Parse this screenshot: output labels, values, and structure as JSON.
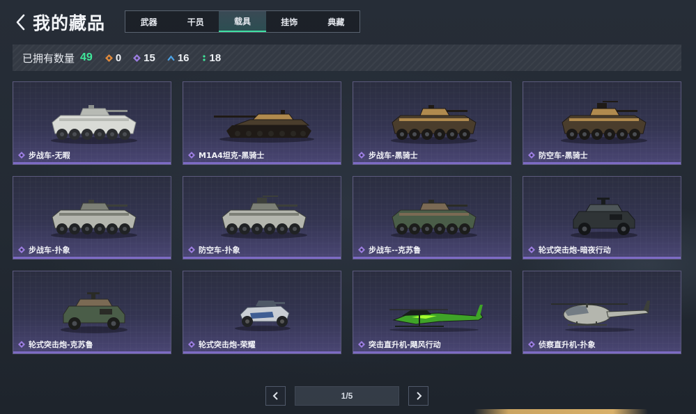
{
  "header": {
    "back_icon": "chevron-left-icon",
    "title": "我的藏品",
    "tabs": [
      {
        "label": "武器",
        "active": false
      },
      {
        "label": "干员",
        "active": false
      },
      {
        "label": "载具",
        "active": true
      },
      {
        "label": "挂饰",
        "active": false
      },
      {
        "label": "典藏",
        "active": false
      }
    ],
    "accent_color": "#3fe0a3"
  },
  "counts": {
    "label": "已拥有数量",
    "total": "49",
    "stats": [
      {
        "icon": "orange-diamond-icon",
        "color": "#e08a3c",
        "value": "0"
      },
      {
        "icon": "purple-diamond-icon",
        "color": "#9b7de0",
        "value": "15"
      },
      {
        "icon": "blue-chevron-icon",
        "color": "#4da3e6",
        "value": "16"
      },
      {
        "icon": "green-dots-icon",
        "color": "#3fe89b",
        "value": "18"
      }
    ]
  },
  "items": [
    {
      "name": "步战车-无暇",
      "kind": "apc",
      "palette": "snow"
    },
    {
      "name": "M1A4坦克-黑骑士",
      "kind": "tank",
      "palette": "darkgold"
    },
    {
      "name": "步战车-黑骑士",
      "kind": "apc",
      "palette": "darkgold"
    },
    {
      "name": "防空车-黑骑士",
      "kind": "aa",
      "palette": "darkgold"
    },
    {
      "name": "步战车-扑象",
      "kind": "apc",
      "palette": "camo"
    },
    {
      "name": "防空车-扑象",
      "kind": "aa",
      "palette": "camo"
    },
    {
      "name": "步战车--克苏鲁",
      "kind": "apc",
      "palette": "cthulhu"
    },
    {
      "name": "轮式突击炮-暗夜行动",
      "kind": "jeep",
      "palette": "night"
    },
    {
      "name": "轮式突击炮-克苏鲁",
      "kind": "jeep",
      "palette": "cthulhu"
    },
    {
      "name": "轮式突击炮-荣耀",
      "kind": "buggy",
      "palette": "glory"
    },
    {
      "name": "突击直升机-飓风行动",
      "kind": "gunship",
      "palette": "neon"
    },
    {
      "name": "侦察直升机-扑象",
      "kind": "scout",
      "palette": "camo"
    }
  ],
  "rarity_icon": "purple-diamond-icon",
  "rarity_color": "#9b7de0",
  "pager": {
    "prev_icon": "chevron-left-icon",
    "next_icon": "chevron-right-icon",
    "page_text": "1/5"
  }
}
